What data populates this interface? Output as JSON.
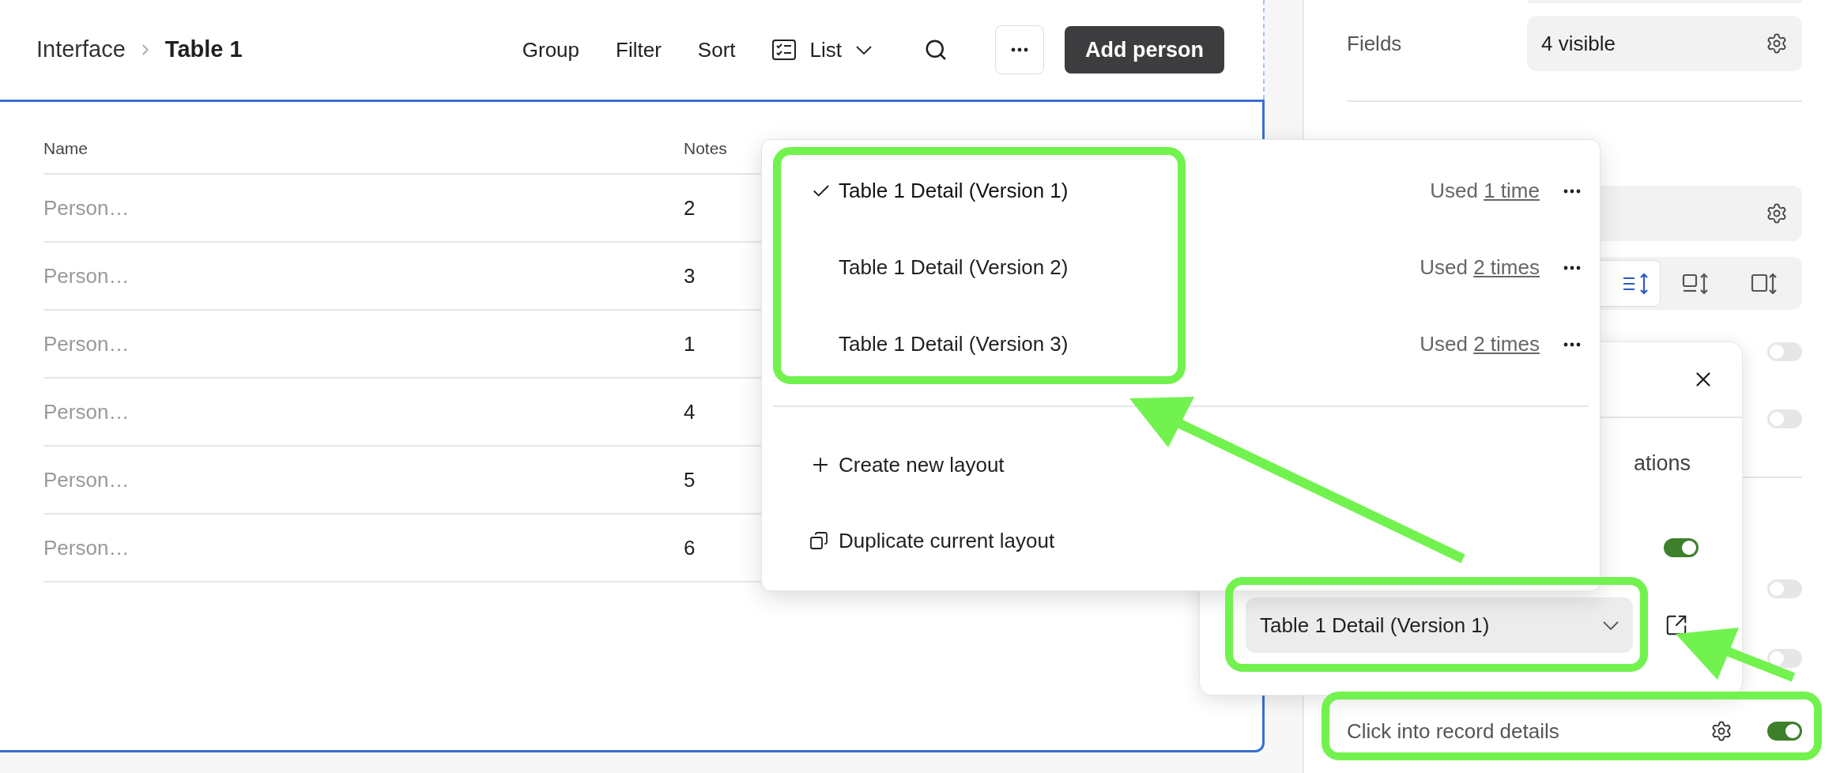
{
  "breadcrumb": {
    "parent": "Interface",
    "current": "Table 1"
  },
  "toolbar": {
    "items": [
      {
        "kind": "text",
        "label": "Group"
      },
      {
        "kind": "text",
        "label": "Filter"
      },
      {
        "kind": "text",
        "label": "Sort"
      },
      {
        "kind": "view",
        "label": "List"
      }
    ],
    "primary_button": "Add person"
  },
  "table": {
    "columns": [
      "Name",
      "Notes"
    ],
    "rows": [
      {
        "name": "Person…",
        "notes": "2"
      },
      {
        "name": "Person…",
        "notes": "3"
      },
      {
        "name": "Person…",
        "notes": "1"
      },
      {
        "name": "Person…",
        "notes": "4"
      },
      {
        "name": "Person…",
        "notes": "5"
      },
      {
        "name": "Person…",
        "notes": "6"
      }
    ]
  },
  "settings_panel": {
    "fields": {
      "label": "Fields",
      "value": "4 visible"
    },
    "layout_options": [
      {
        "selected": true
      },
      {
        "selected": false
      },
      {
        "selected": false
      }
    ],
    "toggles_upper": [
      {
        "on": false
      },
      {
        "on": false
      }
    ],
    "toggles_lower": [
      {
        "on": false
      },
      {
        "on": false
      }
    ],
    "record_details": {
      "label": "Click into record details",
      "on": true
    }
  },
  "detail_popup": {
    "partial_text": "ations",
    "toggle_on": true,
    "layout_select": "Table 1 Detail (Version 1)"
  },
  "layout_menu": {
    "layouts": [
      {
        "name": "Table 1 Detail (Version 1)",
        "selected": true,
        "usage_prefix": "Used",
        "usage_link": "1 time"
      },
      {
        "name": "Table 1 Detail (Version 2)",
        "selected": false,
        "usage_prefix": "Used",
        "usage_link": "2 times"
      },
      {
        "name": "Table 1 Detail (Version 3)",
        "selected": false,
        "usage_prefix": "Used",
        "usage_link": "2 times"
      }
    ],
    "actions": [
      {
        "kind": "create",
        "label": "Create new layout"
      },
      {
        "kind": "duplicate",
        "label": "Duplicate current layout"
      }
    ]
  }
}
